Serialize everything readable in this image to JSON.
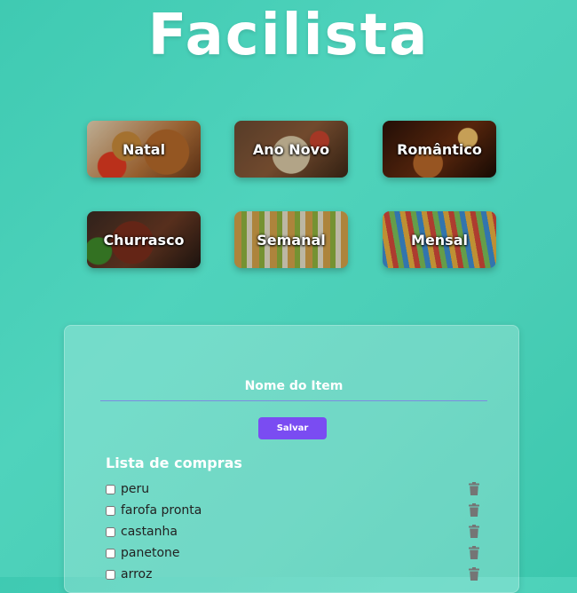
{
  "app": {
    "title": "Facilista"
  },
  "categories": [
    {
      "label": "Natal"
    },
    {
      "label": "Ano Novo"
    },
    {
      "label": "Romântico"
    },
    {
      "label": "Churrasco"
    },
    {
      "label": "Semanal"
    },
    {
      "label": "Mensal"
    }
  ],
  "form": {
    "placeholder": "Nome do Item",
    "save_label": "Salvar"
  },
  "list": {
    "title": "Lista de compras",
    "items": [
      {
        "text": "peru"
      },
      {
        "text": "farofa pronta"
      },
      {
        "text": "castanha"
      },
      {
        "text": "panetone"
      },
      {
        "text": "arroz"
      }
    ]
  },
  "icons": {
    "trash": "trash-icon"
  },
  "colors": {
    "background": "#49cdb5",
    "accent": "#7a4cf2",
    "text": "#ffffff"
  }
}
